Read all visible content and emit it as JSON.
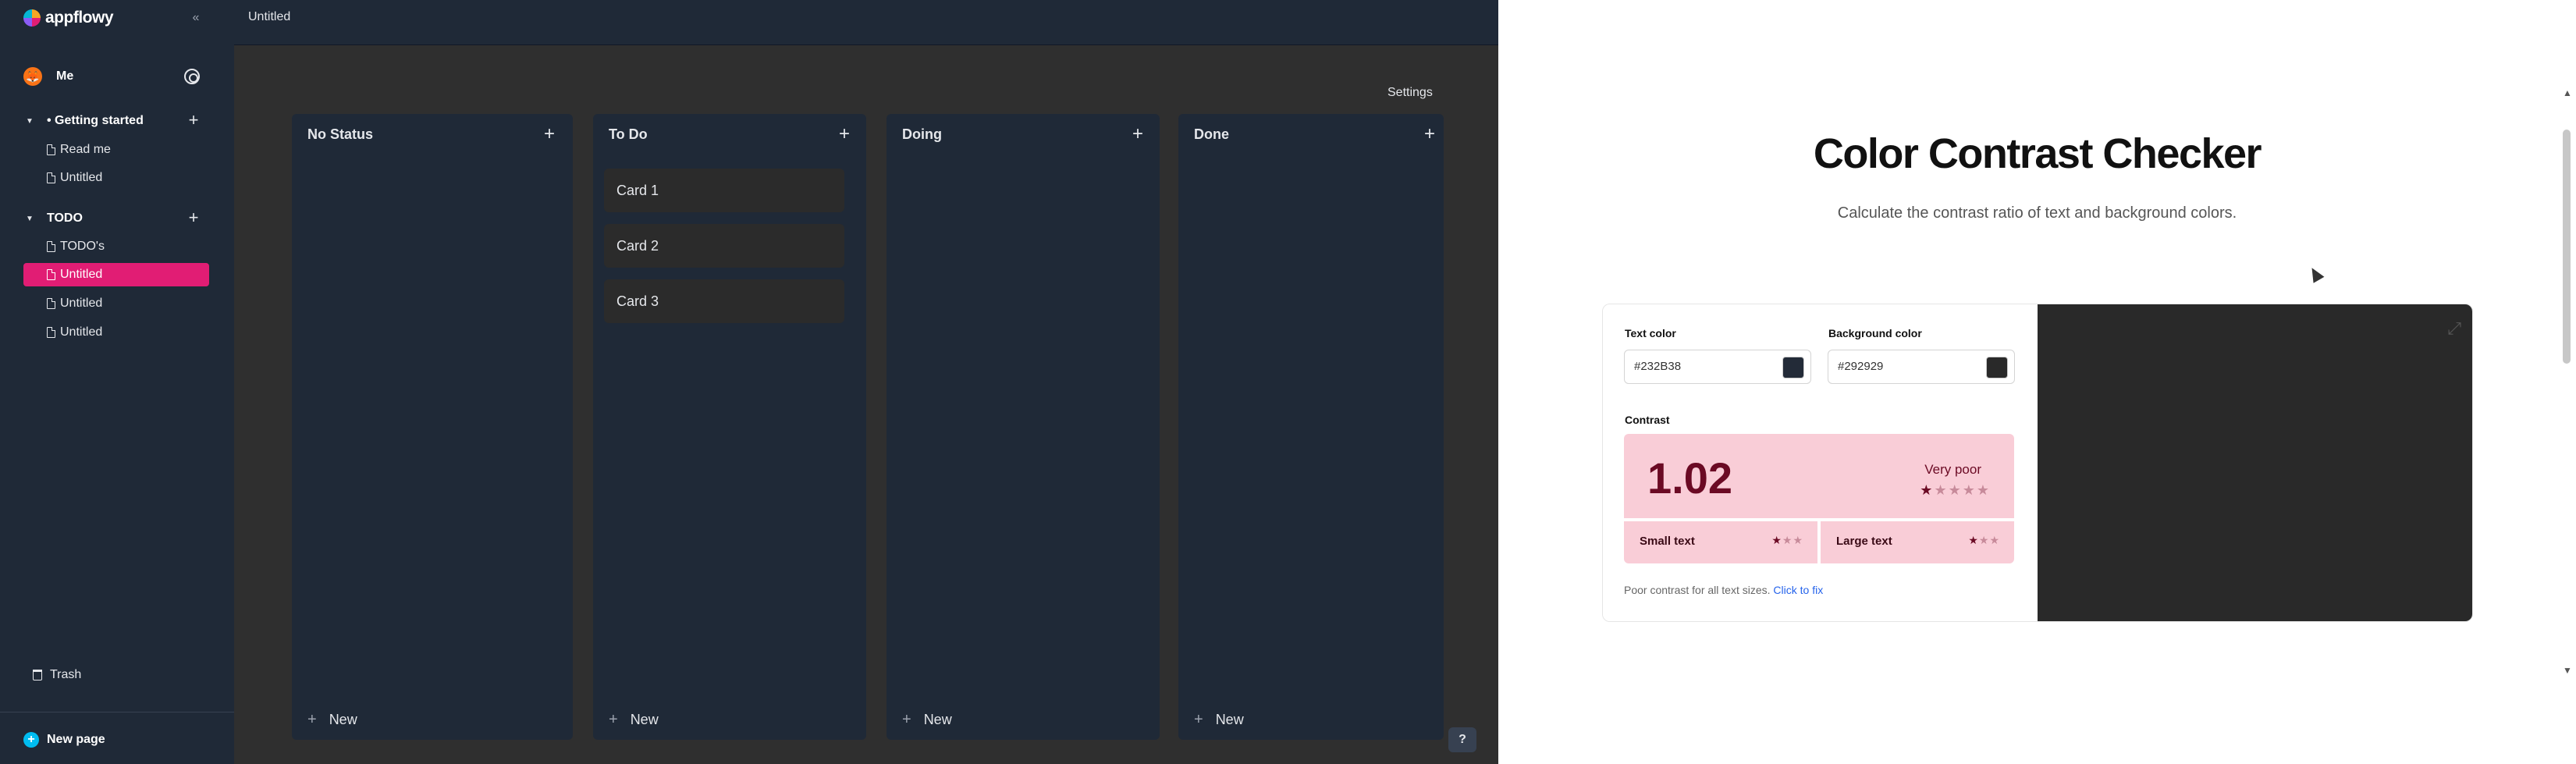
{
  "app": {
    "brand": "appflowy",
    "collapse_icon": "«",
    "user": {
      "name": "Me",
      "avatar_emoji": "🦊"
    },
    "sections": [
      {
        "label": "• Getting started",
        "pages": [
          "Read me",
          "Untitled"
        ]
      },
      {
        "label": "TODO",
        "pages": [
          "TODO's",
          "Untitled",
          "Untitled",
          "Untitled"
        ]
      }
    ],
    "active_page": "Untitled",
    "trash_label": "Trash",
    "new_page_label": "New page"
  },
  "main": {
    "title": "Untitled",
    "settings_label": "Settings",
    "columns": [
      {
        "title": "No Status",
        "cards": [],
        "new_label": "New"
      },
      {
        "title": "To Do",
        "cards": [
          "Card 1",
          "Card 2",
          "Card 3"
        ],
        "new_label": "New"
      },
      {
        "title": "Doing",
        "cards": [],
        "new_label": "New"
      },
      {
        "title": "Done",
        "cards": [],
        "new_label": "New"
      }
    ],
    "help_label": "?"
  },
  "checker": {
    "title": "Color Contrast Checker",
    "subtitle": "Calculate the contrast ratio of text and background colors.",
    "text_color_label": "Text color",
    "text_color_value": "#232B38",
    "background_color_label": "Background color",
    "background_color_value": "#292929",
    "contrast_label": "Contrast",
    "ratio": "1.02",
    "rating": "Very poor",
    "rating_stars": 1,
    "rating_stars_total": 5,
    "small_text_label": "Small text",
    "small_text_stars": 1,
    "large_text_label": "Large text",
    "large_text_stars": 1,
    "size_stars_total": 3,
    "note": "Poor contrast for all text sizes.",
    "fix_link": "Click to fix",
    "colors": {
      "text_swatch": "#232B38",
      "background_swatch": "#292929",
      "contrast_bg": "#f9cdd7",
      "contrast_fg": "#6b0a24",
      "link": "#2563eb"
    }
  }
}
